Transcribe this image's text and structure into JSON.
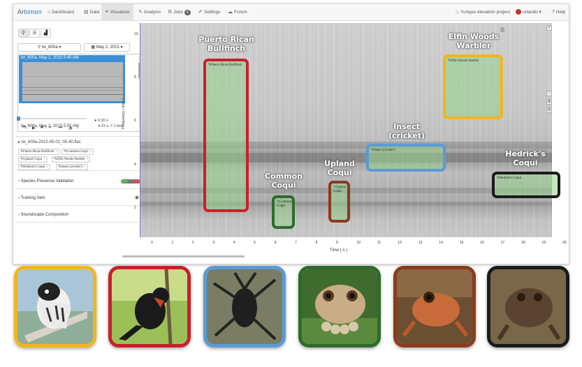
{
  "nav": {
    "logo_prefix": "Ar",
    "logo_suffix": "bimon",
    "items": [
      {
        "id": "dashboard",
        "label": "Dashboard",
        "icon": "⌂"
      },
      {
        "id": "data",
        "label": "Data",
        "icon": "▤"
      },
      {
        "id": "visualizer",
        "label": "Visualizer",
        "icon": "⚭"
      },
      {
        "id": "analysis",
        "label": "Analysis",
        "icon": "✎"
      },
      {
        "id": "jobs",
        "label": "Jobs",
        "icon": "⚙",
        "badge": "0"
      },
      {
        "id": "settings",
        "label": "Settings",
        "icon": "✐"
      },
      {
        "id": "forum",
        "label": "Forum",
        "icon": "☁"
      }
    ],
    "project": "Yunque elevation project",
    "project_icon": "⛬",
    "user": "orlando",
    "help": "Help"
  },
  "left": {
    "site_dropdown": "tw_600a",
    "date_dropdown": "May 2, 2015",
    "recording_selected": "tw_600a, May 2, 2015 5:40 AM",
    "recording_next": "tw_600a, May 2, 2015 5:50 AM",
    "player": {
      "time": "0.00 s",
      "cursor": "4.23 s, 7.1 kHz"
    },
    "filename": "tw_600a-2015-05-02_05-40.flac",
    "tags": [
      "Puerto Rican Bullfinch",
      "Common Coqui",
      "Upland Coqui",
      "Elfin Woods Warbler",
      "Hedrick's Coqui",
      "Insect (cricket?)"
    ],
    "accordions": [
      "Species Presence Validation",
      "Training Sets",
      "Soundscape Composition"
    ]
  },
  "chart": {
    "ylabel": "Frequency ( kHz )",
    "xlabel": "Time ( s )",
    "yticks": [
      "10",
      "8",
      "6",
      "4",
      "2"
    ],
    "xticks": [
      "0",
      "1",
      "2",
      "3",
      "4",
      "5",
      "6",
      "7",
      "8",
      "9",
      "10",
      "11",
      "12",
      "13",
      "14",
      "15",
      "16",
      "17",
      "18",
      "19",
      "20"
    ]
  },
  "rois": [
    {
      "id": "bullfinch",
      "label": "Puerto Rican Bullfinch",
      "box_label": "Puerto Rican Bullfinch",
      "color": "#c8202a",
      "title1": "Puerto Rican",
      "title2": "Bullfinch"
    },
    {
      "id": "common",
      "label": "Common Coqui",
      "box_label": "Common Coqui",
      "color": "#2e6b2a",
      "title1": "Common",
      "title2": "Coqui"
    },
    {
      "id": "upland",
      "label": "Upland Coqui",
      "box_label": "Upland Coqui",
      "color": "#8b3a1e",
      "title1": "Upland",
      "title2": "Coqui"
    },
    {
      "id": "insect",
      "label": "Insect (cricket)",
      "box_label": "Insect (cricket?)",
      "color": "#5b9bd5",
      "title1": "Insect",
      "title2": "(cricket)"
    },
    {
      "id": "elfin",
      "label": "Elfin Woods Warbler",
      "box_label": "Elfin Woods Warbler",
      "color": "#f2b51c",
      "title1": "Elfin Woods",
      "title2": "Warbler"
    },
    {
      "id": "hedrick",
      "label": "Hedrick's Coqui",
      "box_label": "Hedrick's Coqui",
      "color": "#1a1a1a",
      "title1": "Hedrick's",
      "title2": "Coqui"
    }
  ],
  "photos": [
    {
      "id": "warbler",
      "color": "#f2b51c"
    },
    {
      "id": "bullfinch",
      "color": "#c8202a"
    },
    {
      "id": "cricket",
      "color": "#5b9bd5"
    },
    {
      "id": "common-coqui",
      "color": "#2e6b2a"
    },
    {
      "id": "upland-coqui",
      "color": "#8b3a1e"
    },
    {
      "id": "hedrick-coqui",
      "color": "#1a1a1a"
    }
  ]
}
